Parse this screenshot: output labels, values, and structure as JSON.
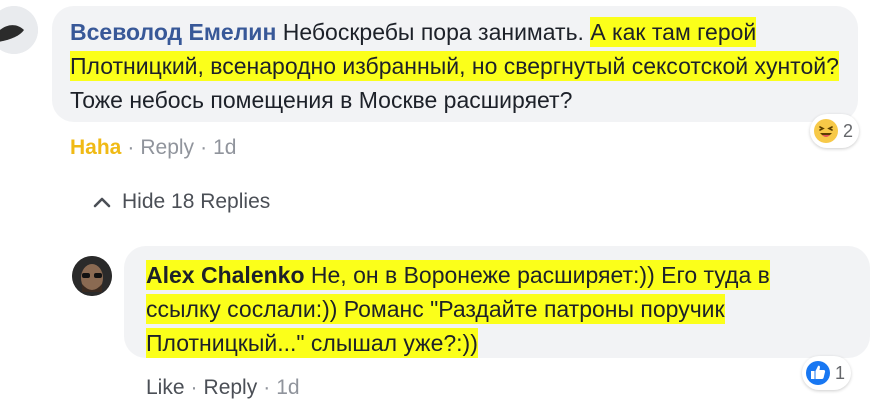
{
  "comment": {
    "author": "Всеволод Емелин",
    "text_plain": "Небоскребы пора занимать.",
    "text_highlight_1": "А как там герой Плотницкий, всенародно избранный, но свергнутый сексотской хунтой?",
    "text_plain_2": "Тоже небось помещения в Москве расширяет?",
    "reaction_count": "2",
    "reaction_icon": "haha-emoji-icon",
    "actions": {
      "reaction_label": "Haha",
      "reply_label": "Reply",
      "time": "1d"
    }
  },
  "replies_toggle": {
    "label": "Hide 18 Replies",
    "icon": "chevron-up-icon"
  },
  "reply": {
    "author": "Alex Chalenko",
    "text": "Не, он в Воронеже расширяет:)) Его туда в ссылку сослали:)) Романс \"Раздайте патроны поручик Плотницкый...\" слышал уже?:))",
    "reaction_count": "1",
    "reaction_icon": "like-thumb-icon",
    "actions": {
      "like_label": "Like",
      "reply_label": "Reply",
      "time": "1d"
    }
  },
  "colors": {
    "highlight": "#fbff1a",
    "link": "#385898",
    "bubble": "#f2f3f5",
    "haha": "#f0ba15",
    "like": "#1877f2"
  }
}
